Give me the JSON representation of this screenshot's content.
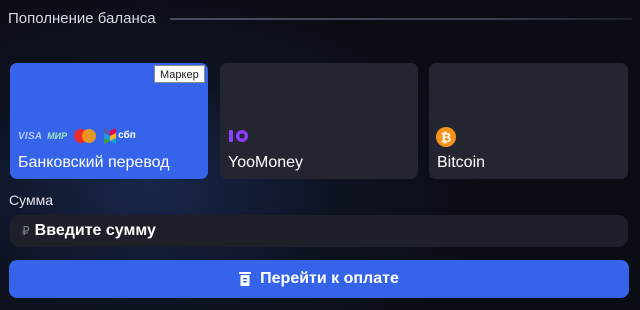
{
  "header": {
    "title": "Пополнение баланса"
  },
  "methods": [
    {
      "label": "Банковский перевод",
      "selected": true,
      "logos": [
        "visa-logo",
        "mir-logo",
        "mastercard-logo",
        "sbp-logo"
      ]
    },
    {
      "label": "YooMoney",
      "icon": "yoomoney-icon"
    },
    {
      "label": "Bitcoin",
      "icon": "bitcoin-icon"
    }
  ],
  "logos": {
    "visa": "VISA",
    "mir": "МИР",
    "sbp": "сбп",
    "bitcoin_glyph": "₿"
  },
  "tooltip": {
    "text": "Маркер"
  },
  "amount": {
    "label": "Сумма",
    "currency_symbol": "₽",
    "placeholder": "Введите сумму",
    "value": ""
  },
  "pay_button": {
    "label": "Перейти к оплате",
    "icon": "payment-icon"
  },
  "colors": {
    "accent": "#3564ea",
    "card_bg": "#232630",
    "page_bg": "#0b0d14",
    "input_bg": "#1e2029",
    "bitcoin": "#f7931a",
    "yoomoney": "#8b3ffd"
  }
}
